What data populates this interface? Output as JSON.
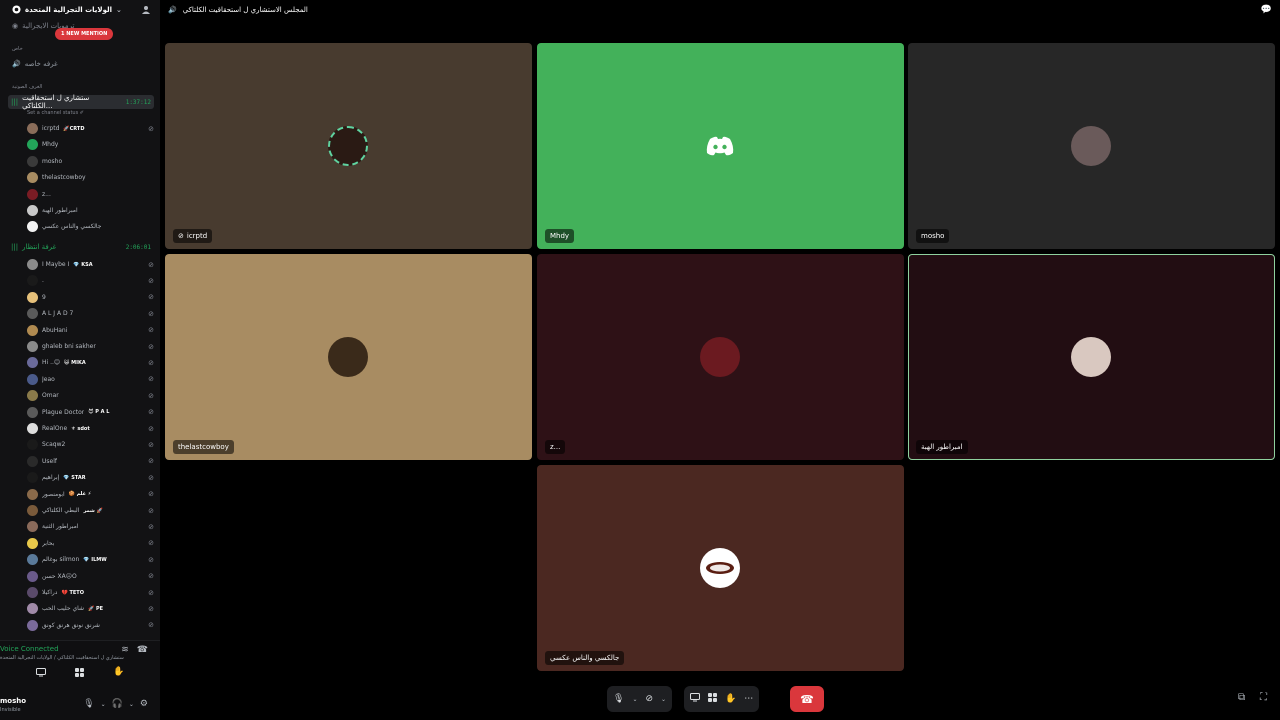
{
  "server": {
    "name": "الولايات التجرالية المتحدة",
    "mention_pill": "1 NEW MENTION",
    "faded_channel": "ترمويات الايجرالية"
  },
  "categories": {
    "private": "خاص",
    "voice": "الغرف الصوتية"
  },
  "text_channels": [
    {
      "name": "غرفه خاصه"
    }
  ],
  "voice_channels": [
    {
      "name": "ستشاري ل استحقاقيت الكلتاكي...",
      "time": "1:37:12",
      "status_placeholder": "Set a channel status ✐"
    },
    {
      "name": "غرفة انتظار",
      "time": "2:06:01"
    }
  ],
  "members_ch1": [
    {
      "name": "icrptd",
      "tag": "🚀CRTD",
      "color": "#8a6d5a"
    },
    {
      "name": "Mhdy",
      "tag": "",
      "color": "#23a55a"
    },
    {
      "name": "mosho",
      "tag": "",
      "color": "#3a3a3a"
    },
    {
      "name": "thelastcowboy",
      "tag": "",
      "color": "#a88c62"
    },
    {
      "name": "z...",
      "tag": "",
      "color": "#7a1c24"
    },
    {
      "name": "امبراطور الهبة",
      "tag": "",
      "color": "#c8c8c8"
    },
    {
      "name": "جالكسي والناس عكسي",
      "tag": "",
      "color": "#f2f2f2"
    }
  ],
  "members_ch2": [
    {
      "name": "I Maybe I",
      "tag": "💎 KSA",
      "color": "#8b8b8b"
    },
    {
      "name": ".",
      "tag": "",
      "color": "#1a1a1a"
    },
    {
      "name": "9",
      "tag": "",
      "color": "#e6c07a"
    },
    {
      "name": "A L J A D 7",
      "tag": "",
      "color": "#5a5a5a"
    },
    {
      "name": "AbuHani",
      "tag": "",
      "color": "#b08a50"
    },
    {
      "name": "ghaleb bni sakher",
      "tag": "",
      "color": "#8a8a8a"
    },
    {
      "name": "Hi ..😊",
      "tag": "😺 MIKA",
      "color": "#6a6a9a"
    },
    {
      "name": "Jeao",
      "tag": "",
      "color": "#4a5a8a"
    },
    {
      "name": "Omar",
      "tag": "",
      "color": "#8a7a4a"
    },
    {
      "name": "Plague Doctor",
      "tag": "😈 P A L",
      "color": "#5a5a5a"
    },
    {
      "name": "RealOne",
      "tag": "⚜ sdot",
      "color": "#dddddd"
    },
    {
      "name": "Scaqw2",
      "tag": "",
      "color": "#1a1a1a"
    },
    {
      "name": "Uself",
      "tag": "",
      "color": "#2a2a2a"
    },
    {
      "name": "إبراهيم",
      "tag": "💎 STAR",
      "color": "#1a1a1a"
    },
    {
      "name": "ابومنصور",
      "tag": "🍪 غلم ⚡",
      "color": "#8a6a4a"
    },
    {
      "name": "البطي الكلتاكي",
      "tag": "شمر 🚀",
      "color": "#7a5a3a"
    },
    {
      "name": "امبراطور الثنية",
      "tag": "",
      "color": "#8a6a5a"
    },
    {
      "name": "بحابر",
      "tag": "",
      "color": "#e8c84a"
    },
    {
      "name": "بوغالم silmon",
      "tag": "💎 ILMW",
      "color": "#5a7a9a"
    },
    {
      "name": "حسن XA☹O",
      "tag": "",
      "color": "#6a5a8a"
    },
    {
      "name": "دراكيلا",
      "tag": "💔 TETO",
      "color": "#5a4a6a"
    },
    {
      "name": "شاي حليب الحب",
      "tag": "🚀 PE",
      "color": "#a08aa8"
    },
    {
      "name": "شرنق نونق هرنق كونق",
      "tag": "",
      "color": "#7a6a9a"
    }
  ],
  "voice_panel": {
    "title": "Voice Connected",
    "subtitle": "ستشاري ل استحقاقيت الكلتاكي / الولايات التجرالية المتحدة"
  },
  "user": {
    "name": "mosho",
    "status": "Invisible"
  },
  "topbar": {
    "channel_name": "المجلس الاستشاري ل استحقاقيت الكلتاكي"
  },
  "tiles": [
    {
      "label": "icrptd",
      "bg": "#483b2f",
      "avatar": "#2a1a14"
    },
    {
      "label": "Mhdy",
      "bg": "#43b15a",
      "avatar": "discord"
    },
    {
      "label": "mosho",
      "bg": "#272727",
      "avatar": "#6a5a5a"
    },
    {
      "label": "thelastcowboy",
      "bg": "#a88c62",
      "avatar": "#3a2a1a"
    },
    {
      "label": "z...",
      "bg": "#2e1116",
      "avatar": "#6b1a20"
    },
    {
      "label": "امبراطور الهبة",
      "bg": "#220d12",
      "avatar": "#d9c8c0"
    },
    {
      "label": "جالكسي والناس عكسي",
      "bg": "#4b2821",
      "avatar": "#ffffff"
    }
  ],
  "colors": {
    "accent_green": "#23a55a",
    "danger": "#da373c",
    "sidebar_bg": "#121214"
  }
}
